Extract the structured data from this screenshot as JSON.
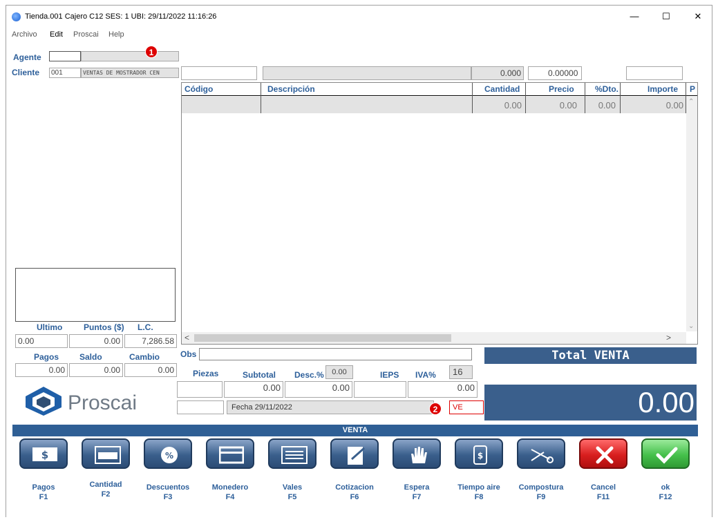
{
  "window": {
    "title": "Tienda.001  Cajero C12    SES: 1   UBI:   29/11/2022 11:16:26"
  },
  "menu": [
    "Archivo",
    "Edit",
    "Proscai",
    "Help"
  ],
  "form": {
    "agente_label": "Agente",
    "cliente_label": "Cliente",
    "cliente_code": "001",
    "cliente_name": "VENTAS DE MOSTRADOR CEN",
    "field_a": "0.000",
    "field_b": "0.00000"
  },
  "grid": {
    "headers": [
      "Código",
      "Descripción",
      "Cantidad",
      "Precio",
      "%Dto.",
      "Importe",
      "P"
    ],
    "row": {
      "cantidad": "0.00",
      "precio": "0.00",
      "dto": "0.00",
      "importe": "0.00"
    }
  },
  "left": {
    "ultimo_label": "Ultimo",
    "puntos_label": "Puntos ($)",
    "lc_label": "L.C.",
    "ultimo": "0.00",
    "puntos": "0.00",
    "lc": "7,286.58",
    "pagos_label": "Pagos",
    "saldo_label": "Saldo",
    "cambio_label": "Cambio",
    "pagos": "0.00",
    "saldo": "0.00",
    "cambio": "0.00",
    "logo": "Proscai"
  },
  "summary": {
    "obs_label": "Obs",
    "piezas_label": "Piezas",
    "subtotal_label": "Subtotal",
    "desc_label": "Desc.%",
    "desc_value": "0.00",
    "ieps_label": "IEPS",
    "iva_label": "IVA%",
    "iva_value": "16",
    "subtotal": "0.00",
    "ieps": "0.00",
    "iva": "0.00",
    "fecha": "Fecha 29/11/2022",
    "tipo": "VE"
  },
  "total": {
    "title": "Total VENTA",
    "value": "0.00"
  },
  "status_bar": "VENTA",
  "badges": [
    "1",
    "2"
  ],
  "fkeys": [
    {
      "name": "Pagos",
      "key": "F1",
      "icon": "dollar-icon"
    },
    {
      "name": "Cantidad",
      "key": "F2",
      "icon": "calculator-icon"
    },
    {
      "name": "Descuentos",
      "key": "F3",
      "icon": "percent-icon"
    },
    {
      "name": "Monedero",
      "key": "F4",
      "icon": "card-icon"
    },
    {
      "name": "Vales",
      "key": "F5",
      "icon": "voucher-icon"
    },
    {
      "name": "Cotizacion",
      "key": "F6",
      "icon": "edit-icon"
    },
    {
      "name": "Espera",
      "key": "F7",
      "icon": "hand-icon"
    },
    {
      "name": "Tiempo aire",
      "key": "F8",
      "icon": "phone-icon"
    },
    {
      "name": "Compostura",
      "key": "F9",
      "icon": "scissors-icon"
    },
    {
      "name": "Cancel",
      "key": "F11",
      "icon": "x-icon"
    },
    {
      "name": "ok",
      "key": "F12",
      "icon": "check-icon"
    }
  ]
}
